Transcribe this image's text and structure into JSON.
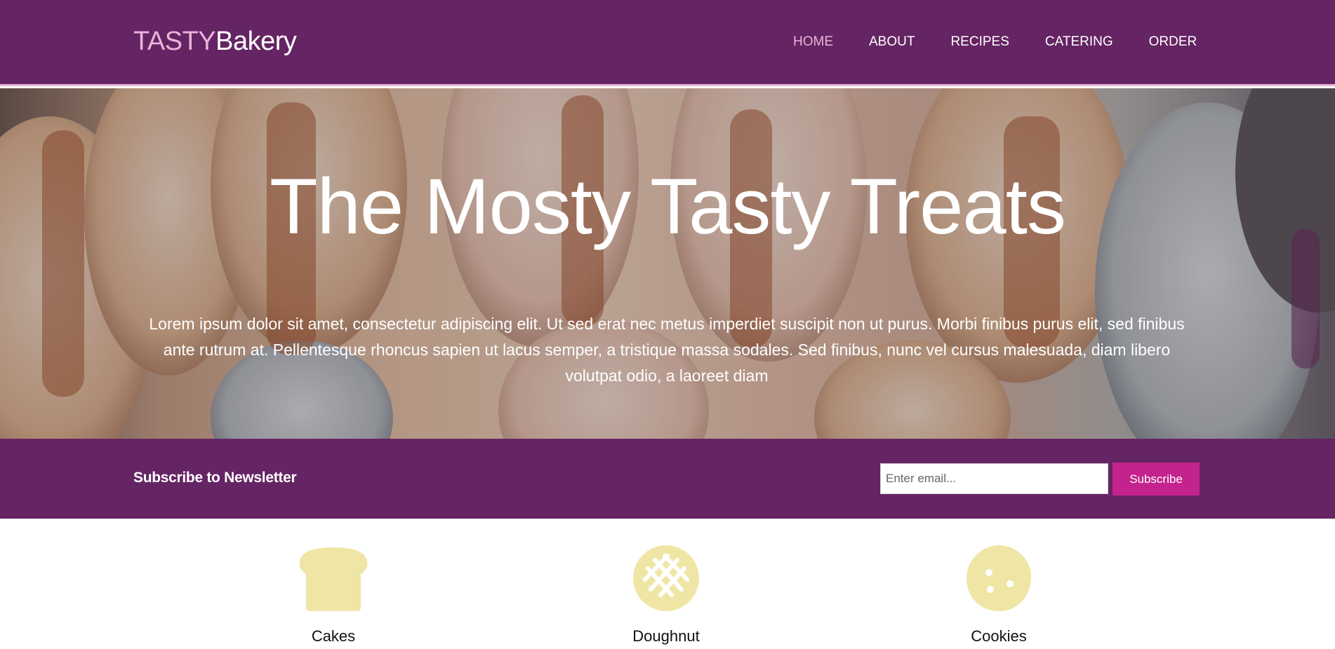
{
  "brand": {
    "part1": "TASTY",
    "part2": "Bakery"
  },
  "nav": [
    {
      "label": "HOME",
      "active": true
    },
    {
      "label": "ABOUT",
      "active": false
    },
    {
      "label": "RECIPES",
      "active": false
    },
    {
      "label": "CATERING",
      "active": false
    },
    {
      "label": "ORDER",
      "active": false
    }
  ],
  "hero": {
    "title": "The Mosty Tasty Treats",
    "text": "Lorem ipsum dolor sit amet, consectetur adipiscing elit. Ut sed erat nec metus imperdiet suscipit non ut purus. Morbi finibus purus elit, sed finibus ante rutrum at. Pellentesque rhoncus sapien ut lacus semper, a tristique massa sodales. Sed finibus, nunc vel cursus malesuada, diam libero volutpat odio, a laoreet diam"
  },
  "newsletter": {
    "label": "Subscribe to Newsletter",
    "placeholder": "Enter email...",
    "button": "Subscribe"
  },
  "products": [
    {
      "name": "Cakes",
      "icon": "bread-icon"
    },
    {
      "name": "Doughnut",
      "icon": "pie-icon"
    },
    {
      "name": "Cookies",
      "icon": "cookie-icon"
    }
  ],
  "colors": {
    "header": "#652463",
    "accent_pink": "#e9b4d8",
    "button": "#c4238e",
    "icon_fill": "#efe6a6"
  }
}
